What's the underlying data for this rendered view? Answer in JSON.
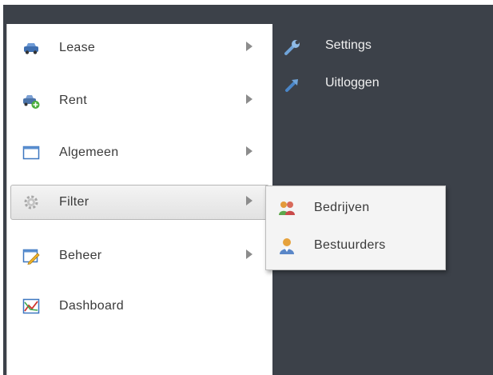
{
  "main_menu": {
    "items": [
      {
        "label": "Lease",
        "icon": "car-icon"
      },
      {
        "label": "Rent",
        "icon": "car-add-icon"
      },
      {
        "label": "Algemeen",
        "icon": "window-icon"
      },
      {
        "label": "Filter",
        "icon": "gear-icon"
      },
      {
        "label": "Beheer",
        "icon": "edit-icon"
      },
      {
        "label": "Dashboard",
        "icon": "chart-icon"
      }
    ],
    "active_item": "Filter"
  },
  "user_links": {
    "settings_label": "Settings",
    "logout_label": "Uitloggen"
  },
  "submenu": {
    "items": [
      {
        "label": "Bedrijven",
        "icon": "group-icon"
      },
      {
        "label": "Bestuurders",
        "icon": "user-icon"
      }
    ]
  },
  "colors": {
    "backdrop": "#3c4149",
    "menu_bg": "#ffffff",
    "submenu_bg": "#f4f4f4",
    "text": "#3a3a3a",
    "link_text": "#f0f0f0"
  }
}
